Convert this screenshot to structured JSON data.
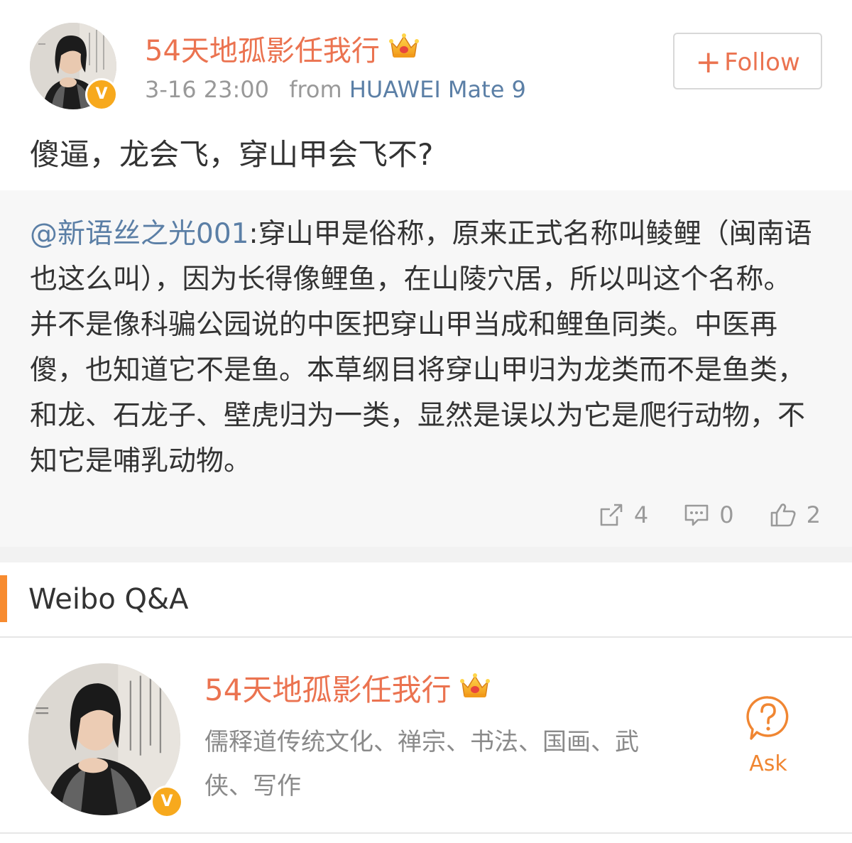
{
  "post": {
    "user_name": "54天地孤影任我行",
    "timestamp": "3-16 23:00",
    "from_label": "from",
    "device": "HUAWEI Mate 9",
    "follow_label": "Follow",
    "verified_badge": "V",
    "text": "傻逼，龙会飞，穿山甲会飞不?"
  },
  "repost": {
    "mention": "@新语丝之光001",
    "text": ":穿山甲是俗称，原来正式名称叫鲮鲤（闽南语也这么叫），因为长得像鲤鱼，在山陵穴居，所以叫这个名称。并不是像科骗公园说的中医把穿山甲当成和鲤鱼同类。中医再傻，也知道它不是鱼。本草纲目将穿山甲归为龙类而不是鱼类，和龙、石龙子、壁虎归为一类，显然是误以为它是爬行动物，不知它是哺乳动物。",
    "share_count": "4",
    "comment_count": "0",
    "like_count": "2"
  },
  "qa": {
    "section_title": "Weibo Q&A",
    "user_name": "54天地孤影任我行",
    "description": "儒释道传统文化、禅宗、书法、国画、武侠、写作",
    "ask_label": "Ask",
    "verified_badge": "V"
  },
  "colors": {
    "name_orange": "#eb7350",
    "link_blue": "#5b7fa6",
    "accent_bar": "#f78b30",
    "badge_gold": "#f7a91d",
    "repost_bg": "#f7f7f7"
  },
  "icons": [
    "crown-icon",
    "plus-icon",
    "share-icon",
    "comment-icon",
    "like-icon",
    "question-icon",
    "verified-icon"
  ]
}
